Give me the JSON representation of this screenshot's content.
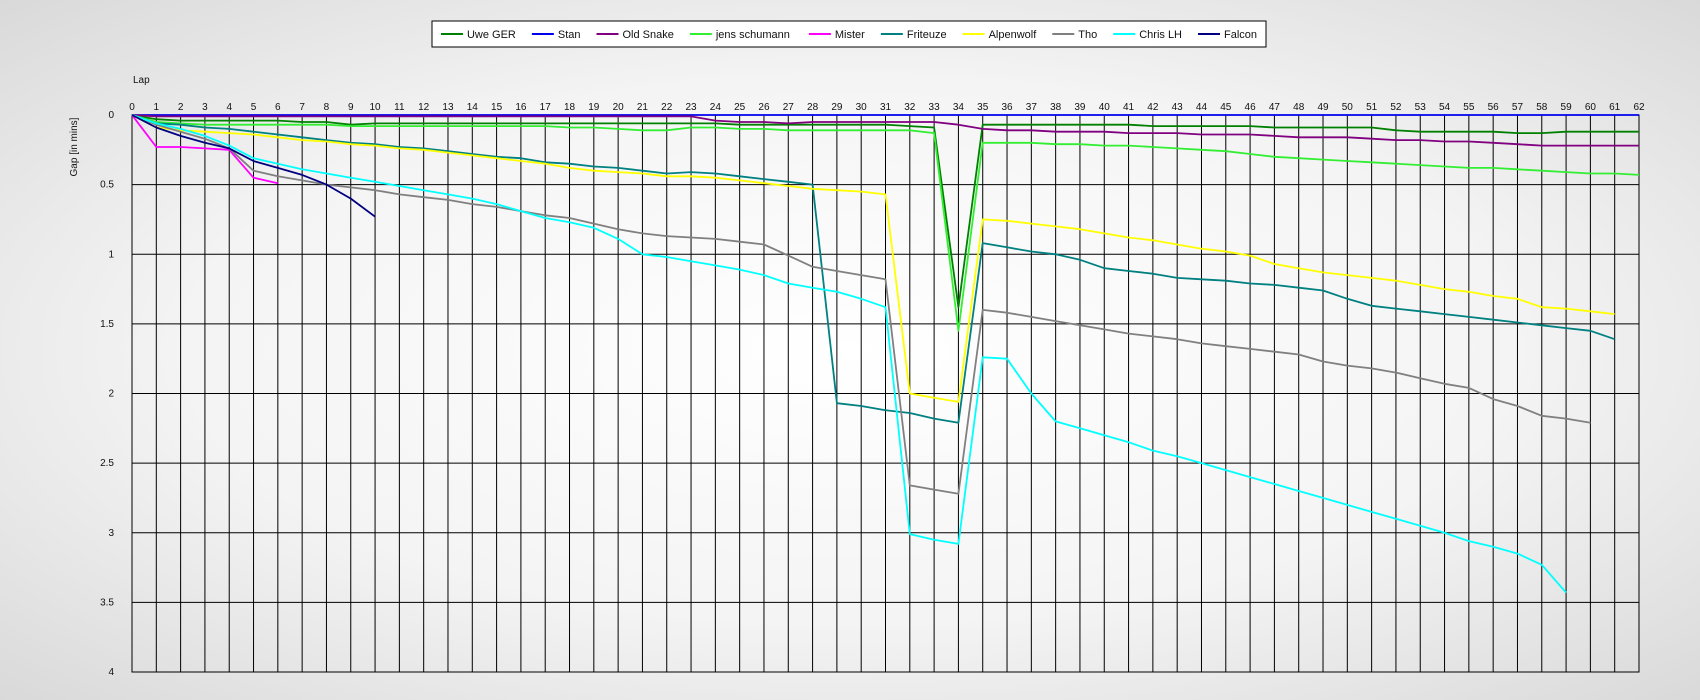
{
  "chart_data": {
    "type": "line",
    "xlabel": "Lap",
    "ylabel": "Gap [in mins]",
    "xlim": [
      0,
      62
    ],
    "ylim": [
      0,
      4
    ],
    "y_inverted": true,
    "y_ticks": [
      0,
      0.5,
      1,
      1.5,
      2,
      2.5,
      3,
      3.5,
      4
    ],
    "y_tick_labels": [
      "0",
      "0.5",
      "1",
      "1.5",
      "2",
      "2.5",
      "3",
      "3.5",
      "4"
    ],
    "x_ticks": [
      0,
      1,
      2,
      3,
      4,
      5,
      6,
      7,
      8,
      9,
      10,
      11,
      12,
      13,
      14,
      15,
      16,
      17,
      18,
      19,
      20,
      21,
      22,
      23,
      24,
      25,
      26,
      27,
      28,
      29,
      30,
      31,
      32,
      33,
      34,
      35,
      36,
      37,
      38,
      39,
      40,
      41,
      42,
      43,
      44,
      45,
      46,
      47,
      48,
      49,
      50,
      51,
      52,
      53,
      54,
      55,
      56,
      57,
      58,
      59,
      60,
      61,
      62
    ],
    "grid": true,
    "legend_position": "top-center",
    "series": [
      {
        "name": "Uwe GER",
        "color": "#008000",
        "x0": 0,
        "values": [
          0,
          0.03,
          0.04,
          0.04,
          0.04,
          0.04,
          0.04,
          0.05,
          0.05,
          0.07,
          0.06,
          0.06,
          0.06,
          0.06,
          0.06,
          0.06,
          0.06,
          0.06,
          0.06,
          0.06,
          0.06,
          0.06,
          0.06,
          0.06,
          0.06,
          0.07,
          0.07,
          0.07,
          0.07,
          0.07,
          0.07,
          0.07,
          0.08,
          0.09,
          1.38,
          0.07,
          0.07,
          0.07,
          0.07,
          0.07,
          0.07,
          0.07,
          0.08,
          0.08,
          0.08,
          0.08,
          0.08,
          0.09,
          0.09,
          0.09,
          0.09,
          0.09,
          0.11,
          0.12,
          0.12,
          0.12,
          0.12,
          0.13,
          0.13,
          0.12,
          0.12,
          0.12,
          0.12
        ]
      },
      {
        "name": "Stan",
        "color": "#0000ee",
        "x0": 0,
        "values": [
          0,
          0,
          0,
          0,
          0,
          0,
          0,
          0,
          0,
          0,
          0,
          0,
          0,
          0,
          0,
          0,
          0,
          0,
          0,
          0,
          0,
          0,
          0,
          0,
          0,
          0,
          0,
          0,
          0,
          0,
          0,
          0,
          0,
          0,
          0,
          0,
          0,
          0,
          0,
          0,
          0,
          0,
          0,
          0,
          0,
          0,
          0,
          0,
          0,
          0,
          0,
          0,
          0,
          0,
          0,
          0,
          0,
          0,
          0,
          0,
          0,
          0,
          0
        ]
      },
      {
        "name": "Old Snake",
        "color": "#800080",
        "x0": 0,
        "values": [
          0,
          0.01,
          0.01,
          0.01,
          0.01,
          0.01,
          0.01,
          0.01,
          0.01,
          0.01,
          0.01,
          0.01,
          0.01,
          0.01,
          0.01,
          0.01,
          0.01,
          0.01,
          0.01,
          0.01,
          0.01,
          0.01,
          0.01,
          0.01,
          0.04,
          0.05,
          0.05,
          0.06,
          0.05,
          0.05,
          0.05,
          0.05,
          0.05,
          0.05,
          0.07,
          0.1,
          0.11,
          0.11,
          0.12,
          0.12,
          0.12,
          0.13,
          0.13,
          0.13,
          0.14,
          0.14,
          0.14,
          0.15,
          0.16,
          0.16,
          0.16,
          0.17,
          0.18,
          0.18,
          0.19,
          0.19,
          0.2,
          0.21,
          0.22,
          0.22,
          0.22,
          0.22,
          0.22
        ]
      },
      {
        "name": "jens  schumann",
        "color": "#33ee33",
        "x0": 0,
        "values": [
          0,
          0.05,
          0.06,
          0.07,
          0.07,
          0.07,
          0.07,
          0.07,
          0.07,
          0.08,
          0.08,
          0.08,
          0.08,
          0.08,
          0.08,
          0.08,
          0.08,
          0.08,
          0.09,
          0.09,
          0.1,
          0.11,
          0.11,
          0.09,
          0.09,
          0.1,
          0.1,
          0.11,
          0.11,
          0.11,
          0.11,
          0.11,
          0.11,
          0.13,
          1.55,
          0.2,
          0.2,
          0.2,
          0.21,
          0.21,
          0.22,
          0.22,
          0.23,
          0.24,
          0.25,
          0.26,
          0.28,
          0.3,
          0.31,
          0.32,
          0.33,
          0.34,
          0.35,
          0.36,
          0.37,
          0.38,
          0.38,
          0.39,
          0.4,
          0.41,
          0.42,
          0.42,
          0.43
        ]
      },
      {
        "name": "Mister",
        "color": "#ff00ff",
        "x0": 0,
        "values": [
          0,
          0.23,
          0.23,
          0.24,
          0.25,
          0.45,
          0.49
        ]
      },
      {
        "name": "Friteuze",
        "color": "#008080",
        "x0": 0,
        "values": [
          0,
          0.06,
          0.07,
          0.09,
          0.1,
          0.12,
          0.14,
          0.16,
          0.18,
          0.2,
          0.21,
          0.23,
          0.24,
          0.26,
          0.28,
          0.3,
          0.31,
          0.34,
          0.35,
          0.37,
          0.38,
          0.4,
          0.42,
          0.41,
          0.42,
          0.44,
          0.46,
          0.48,
          0.5,
          2.07,
          2.09,
          2.12,
          2.14,
          2.18,
          2.21,
          0.92,
          0.95,
          0.98,
          1.0,
          1.04,
          1.1,
          1.12,
          1.14,
          1.17,
          1.18,
          1.19,
          1.21,
          1.22,
          1.24,
          1.26,
          1.32,
          1.37,
          1.39,
          1.41,
          1.43,
          1.45,
          1.47,
          1.49,
          1.51,
          1.53,
          1.55,
          1.61
        ]
      },
      {
        "name": "Alpenwolf",
        "color": "#ffff00",
        "x0": 0,
        "values": [
          0,
          0.09,
          0.11,
          0.12,
          0.13,
          0.14,
          0.16,
          0.18,
          0.19,
          0.21,
          0.22,
          0.24,
          0.25,
          0.27,
          0.29,
          0.31,
          0.33,
          0.35,
          0.38,
          0.4,
          0.41,
          0.42,
          0.44,
          0.44,
          0.45,
          0.47,
          0.49,
          0.51,
          0.53,
          0.54,
          0.55,
          0.57,
          2.0,
          2.03,
          2.06,
          0.75,
          0.76,
          0.78,
          0.8,
          0.82,
          0.85,
          0.88,
          0.9,
          0.93,
          0.96,
          0.98,
          1.01,
          1.07,
          1.1,
          1.13,
          1.15,
          1.17,
          1.19,
          1.22,
          1.25,
          1.27,
          1.3,
          1.32,
          1.38,
          1.39,
          1.41,
          1.43
        ]
      },
      {
        "name": "Tho",
        "color": "#808080",
        "x0": 0,
        "values": [
          0,
          0.07,
          0.12,
          0.17,
          0.24,
          0.4,
          0.44,
          0.47,
          0.5,
          0.52,
          0.54,
          0.57,
          0.59,
          0.61,
          0.64,
          0.66,
          0.69,
          0.72,
          0.74,
          0.78,
          0.82,
          0.85,
          0.87,
          0.88,
          0.89,
          0.91,
          0.93,
          1.01,
          1.09,
          1.12,
          1.15,
          1.18,
          2.66,
          2.69,
          2.72,
          1.4,
          1.42,
          1.45,
          1.48,
          1.51,
          1.54,
          1.57,
          1.59,
          1.61,
          1.64,
          1.66,
          1.68,
          1.7,
          1.72,
          1.77,
          1.8,
          1.82,
          1.85,
          1.89,
          1.93,
          1.96,
          2.04,
          2.09,
          2.16,
          2.18,
          2.21
        ]
      },
      {
        "name": "Chris LH",
        "color": "#00ffff",
        "x0": 0,
        "values": [
          0,
          0.06,
          0.1,
          0.15,
          0.22,
          0.31,
          0.35,
          0.39,
          0.42,
          0.45,
          0.48,
          0.51,
          0.54,
          0.57,
          0.6,
          0.64,
          0.69,
          0.74,
          0.77,
          0.81,
          0.89,
          1.0,
          1.02,
          1.05,
          1.08,
          1.11,
          1.15,
          1.21,
          1.24,
          1.27,
          1.32,
          1.38,
          3.01,
          3.05,
          3.08,
          1.74,
          1.75,
          2.0,
          2.2,
          2.25,
          2.3,
          2.35,
          2.41,
          2.45,
          2.5,
          2.55,
          2.6,
          2.65,
          2.7,
          2.75,
          2.8,
          2.85,
          2.9,
          2.95,
          3.0,
          3.06,
          3.1,
          3.15,
          3.23,
          3.43
        ]
      },
      {
        "name": "Falcon",
        "color": "#000080",
        "x0": 0,
        "values": [
          0,
          0.09,
          0.15,
          0.2,
          0.24,
          0.33,
          0.38,
          0.43,
          0.5,
          0.6,
          0.73
        ]
      }
    ]
  }
}
